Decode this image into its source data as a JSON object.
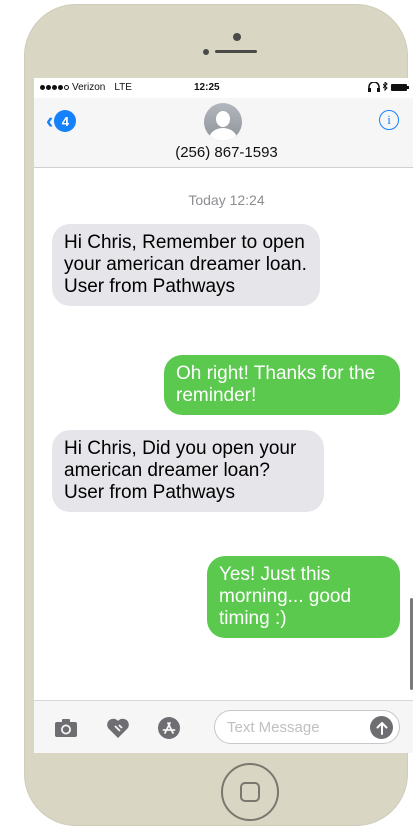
{
  "status_bar": {
    "carrier": "Verizon",
    "network": "LTE",
    "time": "12:25"
  },
  "header": {
    "back_count": "4",
    "contact_number": "(256) 867-1593",
    "info_label": "i"
  },
  "conversation": {
    "timestamp": "Today 12:24",
    "messages": [
      {
        "direction": "incoming",
        "text": "Hi Chris, Remember to open your american dreamer loan. User from Pathways"
      },
      {
        "direction": "outgoing",
        "text": "Oh right! Thanks for the reminder!"
      },
      {
        "direction": "incoming",
        "text": "Hi Chris, Did you open your american dreamer loan? User from Pathways"
      },
      {
        "direction": "outgoing",
        "text": "Yes! Just this morning... good timing :)"
      }
    ]
  },
  "input_bar": {
    "placeholder": "Text Message",
    "icons": [
      "camera-icon",
      "digital-touch-heart-icon",
      "app-store-icon",
      "send-arrow-icon"
    ]
  },
  "colors": {
    "incoming_bubble": "#e5e5ea",
    "outgoing_bubble": "#5ac94d",
    "accent": "#1582fb",
    "phone_body": "#d9d6c4"
  }
}
